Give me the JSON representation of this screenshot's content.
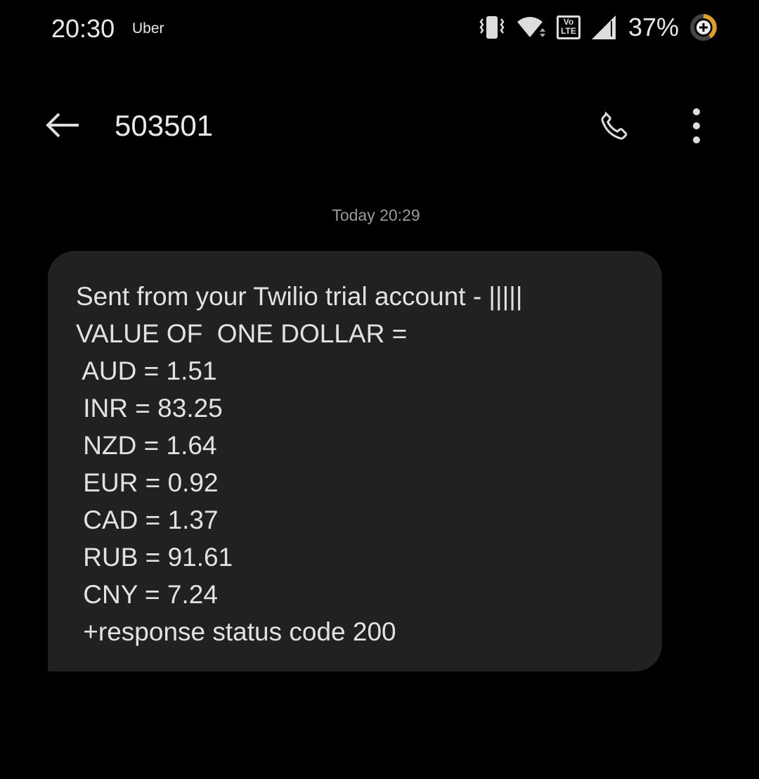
{
  "status_bar": {
    "time": "20:30",
    "notification": "Uber",
    "battery_percent": "37%",
    "icons": [
      "vibrate-icon",
      "wifi-icon",
      "volte-icon",
      "signal-icon",
      "battery-saver-icon"
    ],
    "volte_top": "Vo",
    "volte_bottom": "LTE"
  },
  "app_bar": {
    "title": "503501",
    "icons": [
      "back-arrow-icon",
      "phone-icon",
      "more-vert-icon"
    ]
  },
  "conversation": {
    "timestamp": "Today 20:29",
    "message_lines": [
      "Sent from your Twilio trial account - |||||",
      "VALUE OF  ONE DOLLAR =",
      " AUD = 1.51",
      " INR = 83.25",
      " NZD = 1.64",
      " EUR = 0.92",
      " CAD = 1.37",
      " RUB = 91.61",
      " CNY = 7.24",
      " +response status code 200"
    ]
  },
  "colors": {
    "bubble": "#212121",
    "accent": "#e0a020"
  }
}
